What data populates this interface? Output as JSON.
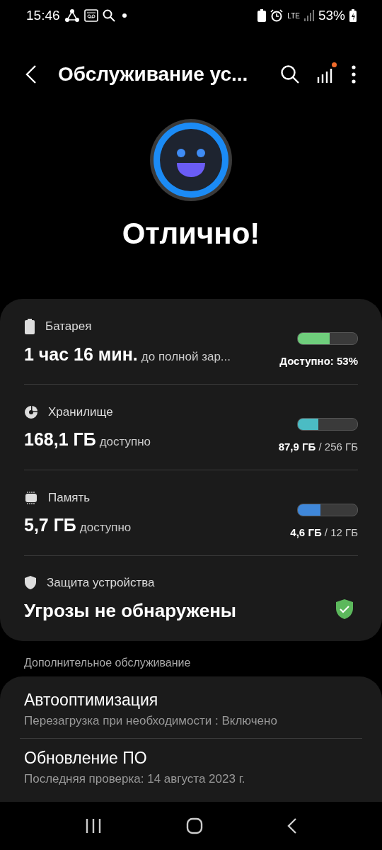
{
  "status_bar": {
    "time": "15:46",
    "network": "LTE",
    "battery": "53%"
  },
  "header": {
    "title": "Обслуживание ус...",
    "notification_dot": true
  },
  "hero": {
    "status": "Отлично!"
  },
  "summary": [
    {
      "kind": "meter",
      "label": "Батарея",
      "value": "1 час 16 мин.",
      "suffix": "до полной зар...",
      "level": 0.53,
      "color": "#6fce7c",
      "reading": "Доступно: 53%"
    },
    {
      "kind": "meter",
      "label": "Хранилище",
      "value": "168,1 ГБ",
      "suffix": "доступно",
      "level": 0.34,
      "color": "#4bbcc4",
      "reading": "**87,9 ГБ** / 256 ГБ"
    },
    {
      "kind": "meter",
      "label": "Память",
      "value": "5,7 ГБ",
      "suffix": "доступно",
      "level": 0.38,
      "color": "#3f87d9",
      "reading": "**4,6 ГБ** / 12 ГБ"
    },
    {
      "kind": "status",
      "label": "Защита устройства",
      "value": "Угрозы не обнаружены",
      "ok": true
    }
  ],
  "extra": {
    "title": "Дополнительное обслуживание",
    "items": [
      {
        "title": "Автооптимизация",
        "subtitle": "Перезагрузка при необходимости : Включено"
      },
      {
        "title": "Обновление ПО",
        "subtitle": "Последняя проверка: 14 августа 2023 г."
      }
    ]
  }
}
